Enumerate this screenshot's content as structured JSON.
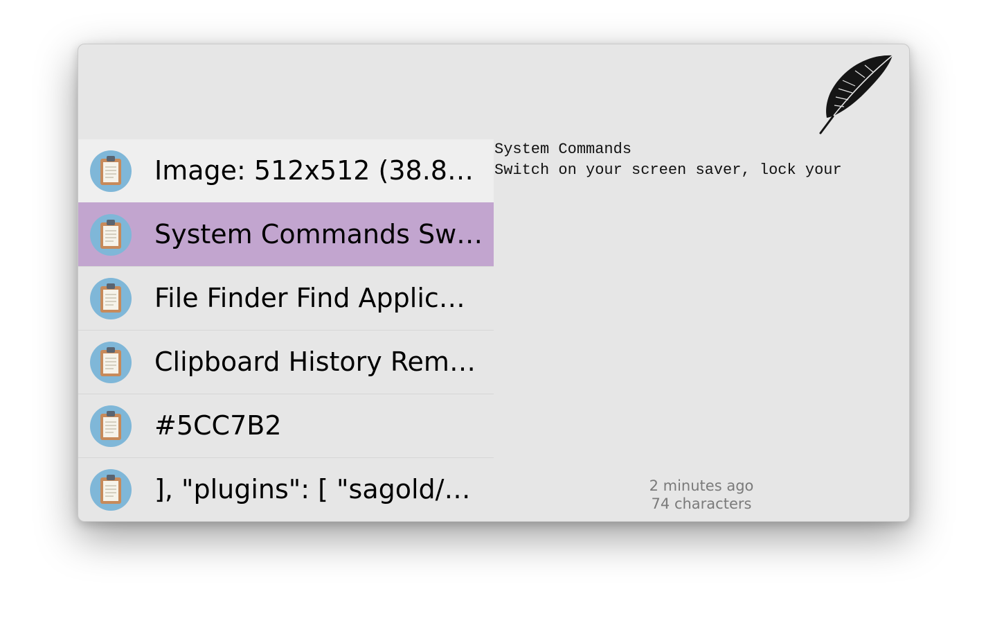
{
  "search": {
    "value": "",
    "placeholder": ""
  },
  "logo": {
    "icon": "feather-icon"
  },
  "results": [
    {
      "title": "Image: 512x512 (38.8…",
      "icon": "clipboard-icon"
    },
    {
      "title": "System Commands Swi…",
      "icon": "clipboard-icon",
      "selected": true
    },
    {
      "title": "File Finder Find Applic…",
      "icon": "clipboard-icon"
    },
    {
      "title": "Clipboard History Rem…",
      "icon": "clipboard-icon"
    },
    {
      "title": "#5CC7B2",
      "icon": "clipboard-icon"
    },
    {
      "title": "], \"plugins\": [ \"sagold/…",
      "icon": "clipboard-icon"
    }
  ],
  "preview": {
    "text": "System Commands\nSwitch on your screen saver, lock your",
    "time": "2 minutes ago",
    "characters": "74 characters"
  },
  "colors": {
    "selection": "#c2a5cf",
    "icon_circle": "#7fb7d8",
    "clipboard_board": "#c78a5a",
    "clipboard_paper": "#f6f3ea"
  }
}
